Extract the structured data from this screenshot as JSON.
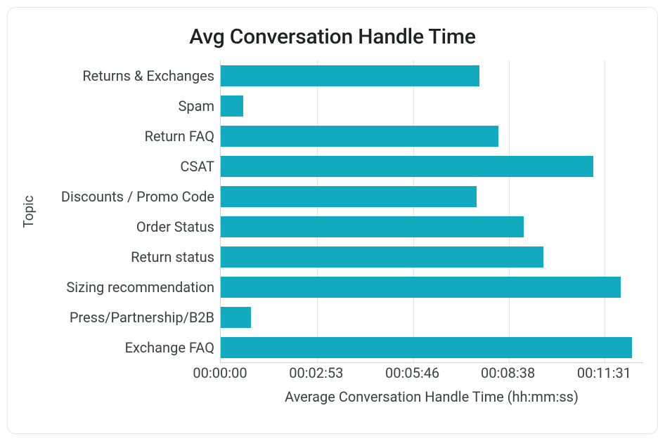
{
  "chart_data": {
    "type": "bar",
    "orientation": "horizontal",
    "title": "Avg Conversation Handle Time",
    "ylabel": "Topic",
    "xlabel": "Average Conversation Handle Time (hh:mm:ss)",
    "categories": [
      "Returns & Exchanges",
      "Spam",
      "Return FAQ",
      "CSAT",
      "Discounts / Promo Code",
      "Order Status",
      "Return status",
      "Sizing recommendation",
      "Press/Partnership/B2B",
      "Exchange FAQ"
    ],
    "values_seconds": [
      465,
      40,
      500,
      670,
      460,
      545,
      580,
      720,
      55,
      740
    ],
    "values_hhmmss": [
      "00:07:45",
      "00:00:40",
      "00:08:20",
      "00:11:10",
      "00:07:40",
      "00:09:05",
      "00:09:40",
      "00:12:00",
      "00:00:55",
      "00:12:20"
    ],
    "x_ticks_seconds": [
      0,
      173,
      346,
      518,
      691
    ],
    "x_ticks_labels": [
      "00:00:00",
      "00:02:53",
      "00:05:46",
      "00:08:38",
      "00:11:31"
    ],
    "x_max_seconds": 760,
    "bar_color": "#12aabf"
  }
}
